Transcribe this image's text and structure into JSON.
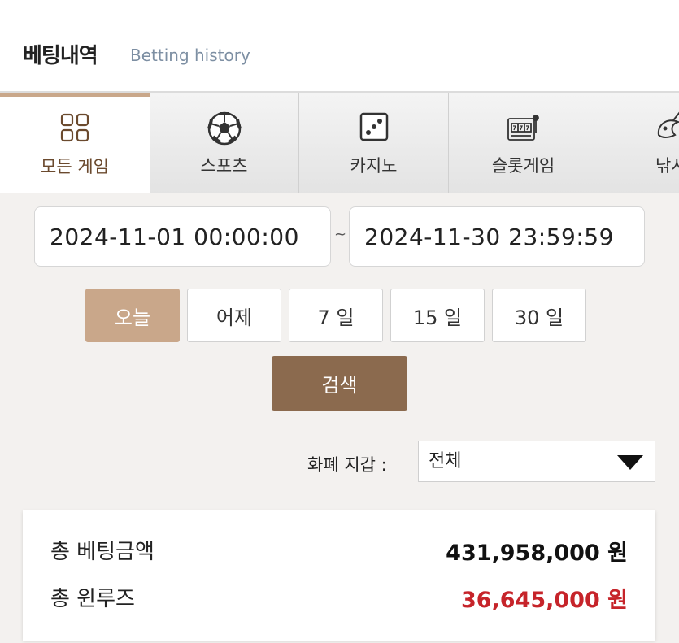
{
  "header": {
    "title": "베팅내역",
    "subtitle": "Betting history"
  },
  "tabs": [
    {
      "label": "모든 게임",
      "icon": "grid-icon",
      "active": true
    },
    {
      "label": "스포츠",
      "icon": "soccer-ball-icon"
    },
    {
      "label": "카지노",
      "icon": "dice-icon"
    },
    {
      "label": "슬롯게임",
      "icon": "slot-machine-icon"
    },
    {
      "label": "낚시",
      "icon": "fish-icon"
    }
  ],
  "date_range": {
    "start": "2024-11-01 00:00:00",
    "separator": "~",
    "end": "2024-11-30 23:59:59"
  },
  "quick_filters": [
    "오늘",
    "어제",
    "7 일",
    "15 일",
    "30 일"
  ],
  "active_quick_filter": "오늘",
  "search_label": "검색",
  "currency": {
    "label": "화폐 지갑 :",
    "selected": "전체"
  },
  "summary": {
    "total_bet_label": "총 베팅금액",
    "total_bet_value": "431,958,000 원",
    "total_winloss_label": "총 윈루즈",
    "total_winloss_value": "36,645,000 원"
  },
  "colors": {
    "accent": "#c9a78a",
    "search": "#8b6a4e",
    "loss": "#c6242a"
  }
}
